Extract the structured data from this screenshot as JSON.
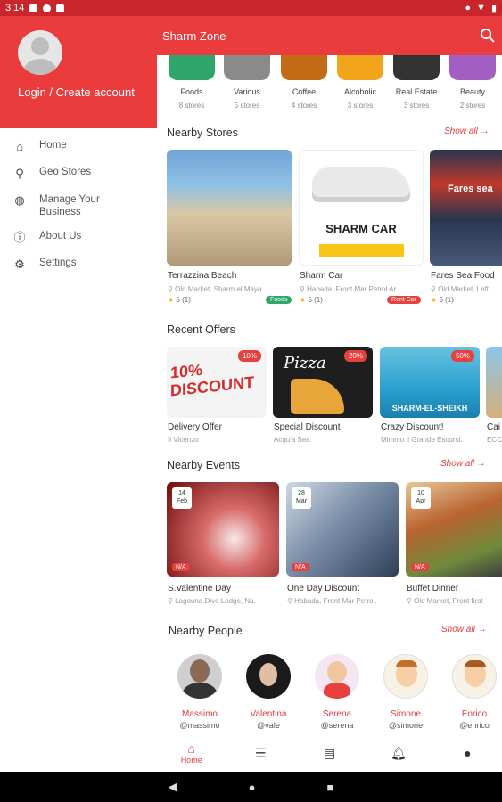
{
  "status": {
    "time": "3:14"
  },
  "drawer": {
    "login": "Login / Create account",
    "items": [
      {
        "label": "Home",
        "icon": "home-icon"
      },
      {
        "label": "Geo Stores",
        "icon": "pin-icon"
      },
      {
        "label": "Manage Your Business",
        "icon": "globe-icon"
      },
      {
        "label": "About Us",
        "icon": "info-icon"
      },
      {
        "label": "Settings",
        "icon": "gear-icon"
      }
    ]
  },
  "topbar": {
    "title": "Sharm Zone"
  },
  "categories": [
    {
      "name": "Foods",
      "count": "8 stores",
      "color": "#2ea56a"
    },
    {
      "name": "Various",
      "count": "5 stores",
      "color": "#8a8a8a"
    },
    {
      "name": "Coffee",
      "count": "4 stores",
      "color": "#c26a14"
    },
    {
      "name": "Alcoholic",
      "count": "3 stores",
      "color": "#f2a51a"
    },
    {
      "name": "Real Estate",
      "count": "3 stores",
      "color": "#333333"
    },
    {
      "name": "Beauty",
      "count": "2 stores",
      "color": "#a35ec2"
    }
  ],
  "nearby_stores": {
    "title": "Nearby Stores",
    "show_all": "Show all",
    "items": [
      {
        "name": "Terrazzina Beach",
        "address": "Old Market, Sharm el Maya",
        "rating": "5 (1)",
        "tag": "Foods",
        "tag_color": "#2ea56a"
      },
      {
        "name": "Sharm Car",
        "address": "Habada, Front Mar Petrol Ar.",
        "rating": "5 (1)",
        "tag": "Rent Car",
        "tag_color": "#e6403f",
        "img_title": "SHARM CAR"
      },
      {
        "name": "Fares Sea Food",
        "address": "Old Market, Left",
        "rating": "5 (1)",
        "img_title": "Fares sea"
      }
    ]
  },
  "recent_offers": {
    "title": "Recent Offers",
    "items": [
      {
        "name": "Delivery Offer",
        "sub": "Il Vicenzo",
        "badge": "10%",
        "img_title": "10% DISCOUNT"
      },
      {
        "name": "Special Discount",
        "sub": "Acqu'a Sea",
        "badge": "20%",
        "img_title": "Pizza"
      },
      {
        "name": "Crazy Discount!",
        "sub": "Mimmo il Grande Escursi.",
        "badge": "50%",
        "img_title": "SHARM-EL-SHEIKH"
      },
      {
        "name": "Cai",
        "sub": "ECC"
      }
    ]
  },
  "nearby_events": {
    "title": "Nearby Events",
    "show_all": "Show all",
    "items": [
      {
        "name": "S.Valentine Day",
        "address": "Lagouna Dive Lodge, Na.",
        "day": "14",
        "month": "Feb",
        "status": "N/A"
      },
      {
        "name": "One Day Discount",
        "address": "Habada, Front Mar Petrol.",
        "day": "28",
        "month": "Mar",
        "status": "N/A"
      },
      {
        "name": "Buffet Dinner",
        "address": "Old Market, Front first",
        "day": "10",
        "month": "Apr",
        "status": "N/A"
      }
    ]
  },
  "nearby_people": {
    "title": "Nearby People",
    "show_all": "Show all",
    "items": [
      {
        "name": "Massimo",
        "handle": "@massimo"
      },
      {
        "name": "Valentina",
        "handle": "@vale"
      },
      {
        "name": "Serena",
        "handle": "@serena"
      },
      {
        "name": "Simone",
        "handle": "@simone"
      },
      {
        "name": "Enrico",
        "handle": "@enrico"
      }
    ]
  },
  "bottom_nav": {
    "home": "Home"
  }
}
